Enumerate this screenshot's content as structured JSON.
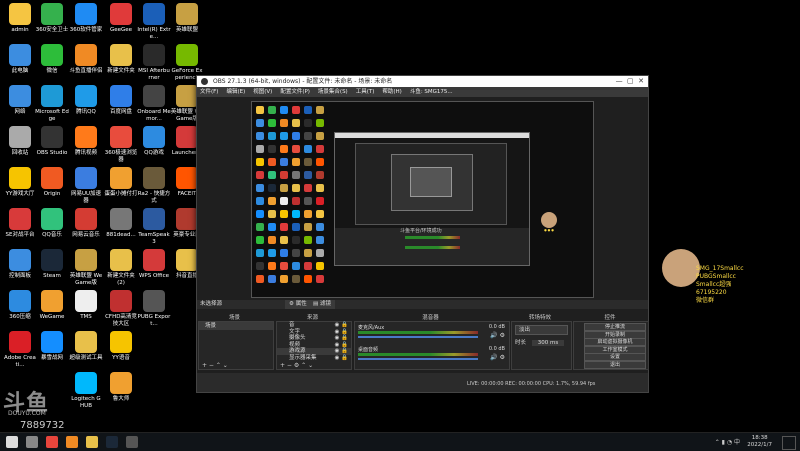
{
  "desktop_icons": [
    {
      "label": "admin",
      "color": "#f5c542"
    },
    {
      "label": "360安全卫士",
      "color": "#35b14d"
    },
    {
      "label": "360软件管家",
      "color": "#1f8bf3"
    },
    {
      "label": "GeeGee",
      "color": "#e03a3a"
    },
    {
      "label": "Intel(R) Extre...",
      "color": "#1b5fb8"
    },
    {
      "label": "英雄联盟",
      "color": "#c7a043"
    },
    {
      "label": "此电脑",
      "color": "#3c8de0"
    },
    {
      "label": "微信",
      "color": "#2dbd3a"
    },
    {
      "label": "斗鱼直播伴侣",
      "color": "#f08a24"
    },
    {
      "label": "新建文件夹",
      "color": "#e8c04a"
    },
    {
      "label": "MSI Afterburner",
      "color": "#2a2a2a"
    },
    {
      "label": "GeForce Experience",
      "color": "#76b900"
    },
    {
      "label": "网络",
      "color": "#3c8de0"
    },
    {
      "label": "Microsoft Edge",
      "color": "#1e9ad6"
    },
    {
      "label": "腾讯QQ",
      "color": "#1f9be8"
    },
    {
      "label": "百度网盘",
      "color": "#2f7ee8"
    },
    {
      "label": "Onboard Memor...",
      "color": "#444"
    },
    {
      "label": "英雄联盟 WeGame版",
      "color": "#c7a043"
    },
    {
      "label": "回收站",
      "color": "#aaa"
    },
    {
      "label": "OBS Studio",
      "color": "#333"
    },
    {
      "label": "腾讯视频",
      "color": "#ff7a1a"
    },
    {
      "label": "360极速浏览器",
      "color": "#e84c3d"
    },
    {
      "label": "QQ游戏",
      "color": "#2d8be0"
    },
    {
      "label": "Launcher...",
      "color": "#d43a3a"
    },
    {
      "label": "YY游戏大厅",
      "color": "#f6c400"
    },
    {
      "label": "Origin",
      "color": "#f05a22"
    },
    {
      "label": "网易UU加速器",
      "color": "#3b7de0"
    },
    {
      "label": "蛋蛋小摊付打",
      "color": "#f0a030"
    },
    {
      "label": "Ra2 - 快捷方式",
      "color": "#6a5a3a"
    },
    {
      "label": "FACEIT",
      "color": "#ff5500"
    },
    {
      "label": "SE对战平台",
      "color": "#d83a3a"
    },
    {
      "label": "QQ音乐",
      "color": "#31c27c"
    },
    {
      "label": "网易云音乐",
      "color": "#d43c33"
    },
    {
      "label": "881dead...",
      "color": "#777"
    },
    {
      "label": "TeamSpeak 3",
      "color": "#2c5aa0"
    },
    {
      "label": "英豪专业版",
      "color": "#b03a2e"
    },
    {
      "label": "控制面板",
      "color": "#3c8de0"
    },
    {
      "label": "Steam",
      "color": "#1b2838"
    },
    {
      "label": "英雄联盟 WeGame版",
      "color": "#c7a043"
    },
    {
      "label": "新建文件夹 (2)",
      "color": "#e8c04a"
    },
    {
      "label": "WPS Office",
      "color": "#d43a3a"
    },
    {
      "label": "抖音直播",
      "color": "#e8c04a"
    },
    {
      "label": "360压缩",
      "color": "#2d8be0"
    },
    {
      "label": "WeGame",
      "color": "#f0a030"
    },
    {
      "label": "TMS",
      "color": "#eee"
    },
    {
      "label": "CFHD高清竞技大区",
      "color": "#c03030"
    },
    {
      "label": "PUBG Export...",
      "color": "#555"
    },
    {
      "label": "",
      "color": "transparent"
    },
    {
      "label": "Adobe Creati...",
      "color": "#da1f26"
    },
    {
      "label": "暴雪战网",
      "color": "#148eff"
    },
    {
      "label": "超级测试工具",
      "color": "#e8c04a"
    },
    {
      "label": "YY语音",
      "color": "#f6c400"
    },
    {
      "label": "",
      "color": "transparent"
    },
    {
      "label": "",
      "color": "transparent"
    },
    {
      "label": "",
      "color": "transparent"
    },
    {
      "label": "",
      "color": "transparent"
    },
    {
      "label": "Logitech G HUB",
      "color": "#00b8fc"
    },
    {
      "label": "鲁大师",
      "color": "#f0a030"
    }
  ],
  "obs": {
    "title": "OBS 27.1.3 (64-bit, windows) - 配置文件: 未命名 - 场景: 未命名",
    "menu": [
      "文件(F)",
      "编辑(E)",
      "视图(V)",
      "配置文件(P)",
      "场景集合(S)",
      "工具(T)",
      "帮助(H)",
      "斗鱼: SMG175..."
    ],
    "no_source": "未选择源",
    "props_btn": "属性",
    "filters_btn": "滤镜",
    "docks": {
      "scenes": "场景",
      "sources": "来源",
      "mixer": "混音器",
      "transitions": "转场特效",
      "controls": "控件"
    },
    "scenes": [
      "场景"
    ],
    "sources": [
      "音",
      "文字",
      "摄像头",
      "视频",
      "游戏源",
      "显示器采集"
    ],
    "mixer": [
      {
        "name": "麦克风/Aux",
        "db": "0.0 dB"
      },
      {
        "name": "桌面音频",
        "db": "0.0 dB"
      }
    ],
    "transition": {
      "type": "淡出",
      "duration_label": "时长",
      "duration": "300 ms"
    },
    "controls": [
      "停止推流",
      "开始录制",
      "启动虚拟摄像机",
      "工作室模式",
      "设置",
      "退出"
    ],
    "status": "LIVE: 00:00:00   REC: 00:00:00   CPU: 1.7%, 59.94 fps",
    "nested_text": "斗鱼平台/环境成功"
  },
  "sticker": {
    "lines": [
      "SMG_17Smallcc",
      "PUBGSmallcc",
      "Smallcc超强",
      "67195220",
      "微信群"
    ]
  },
  "watermark": {
    "logo": "斗鱼",
    "site": "DOUYU.COM",
    "room": "7889732"
  },
  "taskbar": {
    "time": "18:38",
    "date": "2022/1/7",
    "buttons": [
      {
        "name": "start",
        "color": "#ddd"
      },
      {
        "name": "search",
        "color": "#888"
      },
      {
        "name": "chrome",
        "color": "#e8453c"
      },
      {
        "name": "douyu",
        "color": "#f08a24"
      },
      {
        "name": "explorer",
        "color": "#e8c04a"
      },
      {
        "name": "steam",
        "color": "#1b2838"
      },
      {
        "name": "obs",
        "color": "#555"
      }
    ]
  }
}
